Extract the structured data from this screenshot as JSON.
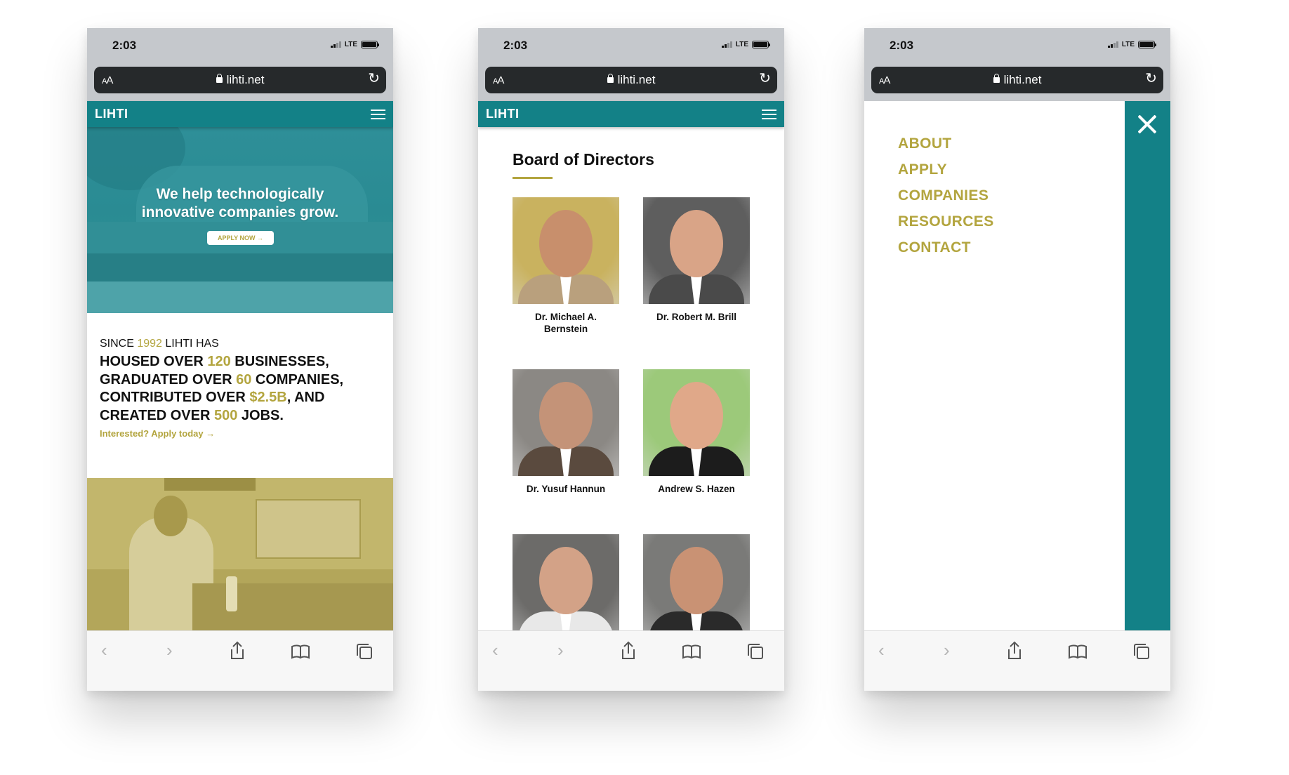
{
  "status": {
    "time": "2:03",
    "network": "LTE"
  },
  "browser": {
    "text_size": "AA",
    "url": "lihti.net"
  },
  "site": {
    "logo": "LIHTI"
  },
  "home": {
    "hero_line1": "We help technologically",
    "hero_line2": "innovative companies grow.",
    "apply_button": "APPLY NOW →",
    "since_prefix": "SINCE ",
    "since_year": "1992",
    "since_suffix": " LIHTI HAS",
    "housed_prefix": "HOUSED OVER ",
    "housed_value": "120",
    "housed_suffix": " BUSINESSES,",
    "graduated_prefix": "GRADUATED OVER ",
    "graduated_value": "60",
    "graduated_suffix": " COMPANIES,",
    "contributed_prefix": "CONTRIBUTED OVER ",
    "contributed_value": "$2.5B",
    "contributed_suffix": ", AND",
    "created_prefix": "CREATED OVER ",
    "created_value": "500",
    "created_suffix": " JOBS.",
    "interested_link": "Interested? Apply today →"
  },
  "board": {
    "title": "Board of Directors",
    "directors": [
      {
        "name": "Dr. Michael A. Bernstein",
        "bg": "#c9b25f",
        "skin": "#c88f6c",
        "suit": "#b9a07d"
      },
      {
        "name": "Dr. Robert M. Brill",
        "bg": "#5e5e5e",
        "skin": "#d9a487",
        "suit": "#4a4a4a"
      },
      {
        "name": "Dr. Yusuf Hannun",
        "bg": "#8b8884",
        "skin": "#c49378",
        "suit": "#5a4a3e"
      },
      {
        "name": "Andrew S. Hazen",
        "bg": "#9cc97a",
        "skin": "#e0a889",
        "suit": "#1c1c1c"
      },
      {
        "name": "",
        "bg": "#6c6b69",
        "skin": "#d3a287",
        "suit": "#e8e8e8"
      },
      {
        "name": "",
        "bg": "#7a7a78",
        "skin": "#c99274",
        "suit": "#2a2a2a"
      }
    ]
  },
  "menu": {
    "items": [
      "ABOUT",
      "APPLY",
      "COMPANIES",
      "RESOURCES",
      "CONTACT"
    ]
  },
  "toolbar": {
    "back": "‹",
    "forward": "›"
  },
  "colors": {
    "teal": "#138187",
    "gold": "#b3a53f",
    "status_bar": "#c5c8cc"
  }
}
